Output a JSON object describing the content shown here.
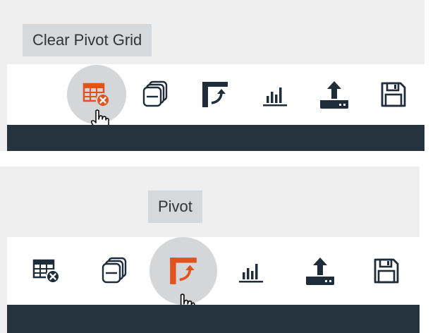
{
  "panels": [
    {
      "tooltip": "Clear Pivot Grid",
      "active_button": "clear-pivot-grid",
      "buttons": [
        {
          "icon": "table-clear-icon",
          "state": "hover"
        },
        {
          "icon": "layers-icon",
          "state": "normal"
        },
        {
          "icon": "pivot-icon",
          "state": "normal"
        },
        {
          "icon": "bar-chart-icon",
          "state": "normal"
        },
        {
          "icon": "export-icon",
          "state": "normal"
        },
        {
          "icon": "save-icon",
          "state": "normal"
        }
      ]
    },
    {
      "tooltip": "Pivot",
      "active_button": "pivot",
      "buttons": [
        {
          "icon": "table-clear-icon",
          "state": "normal"
        },
        {
          "icon": "layers-icon",
          "state": "normal"
        },
        {
          "icon": "pivot-icon",
          "state": "hover"
        },
        {
          "icon": "bar-chart-icon",
          "state": "normal"
        },
        {
          "icon": "export-icon",
          "state": "normal"
        },
        {
          "icon": "save-icon",
          "state": "normal"
        }
      ]
    }
  ],
  "colors": {
    "icon_default": "#1f2d3a",
    "icon_active": "#e0531f",
    "hover_circle": "#d4d6d8",
    "tooltip_bg": "#d5d9dc",
    "dark_bar": "#25333f",
    "panel_bg": "#efefef"
  }
}
